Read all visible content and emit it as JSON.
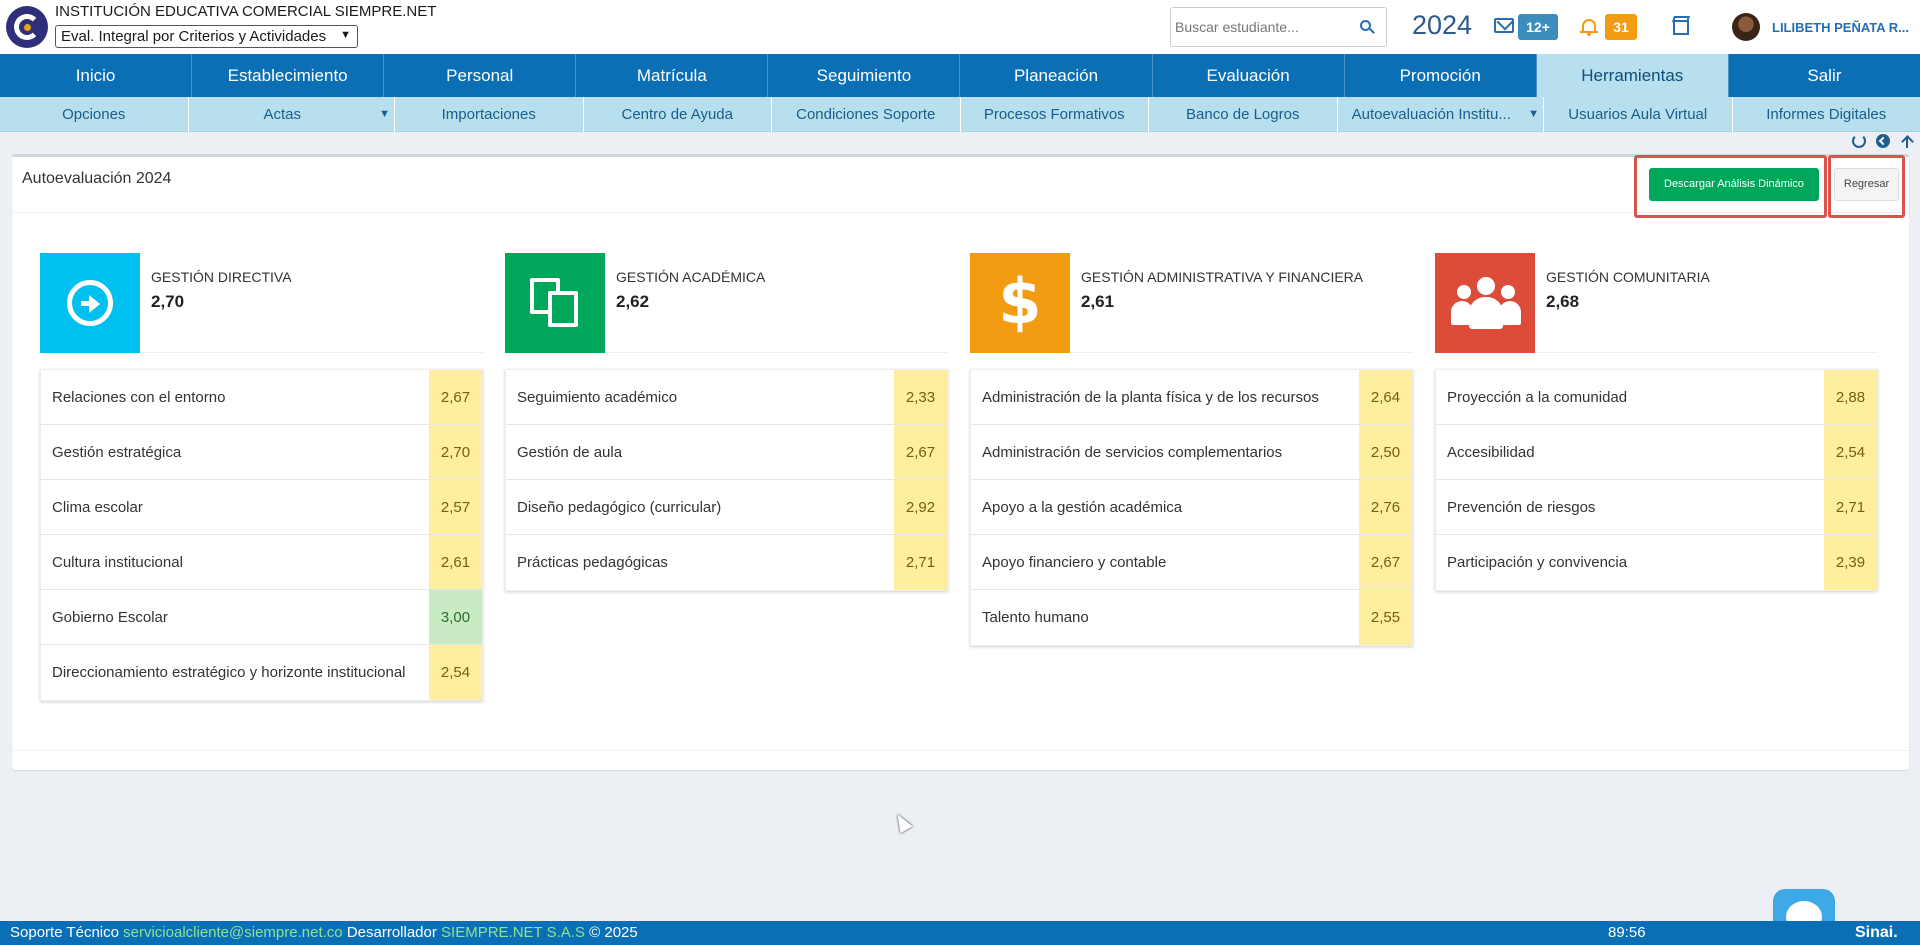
{
  "header": {
    "institution": "INSTITUCIÓN EDUCATIVA COMERCIAL SIEMPRE.NET",
    "period_select": "Eval. Integral por Criterios y Actividades",
    "search_placeholder": "Buscar estudiante...",
    "year": "2024",
    "mail_badge": "12+",
    "notif_badge": "31",
    "user_name": "LILIBETH PEÑATA R...",
    "colors": {
      "mail_badge": "#3c8dbc",
      "notif_badge": "#f39c12"
    }
  },
  "main_menu": [
    "Inicio",
    "Establecimiento",
    "Personal",
    "Matrícula",
    "Seguimiento",
    "Planeación",
    "Evaluación",
    "Promoción",
    "Herramientas",
    "Salir"
  ],
  "main_menu_active": "Herramientas",
  "sub_menu": [
    {
      "label": "Opciones",
      "dropdown": false
    },
    {
      "label": "Actas",
      "dropdown": true
    },
    {
      "label": "Importaciones",
      "dropdown": false
    },
    {
      "label": "Centro de Ayuda",
      "dropdown": false
    },
    {
      "label": "Condiciones Soporte",
      "dropdown": false
    },
    {
      "label": "Procesos Formativos",
      "dropdown": false
    },
    {
      "label": "Banco de Logros",
      "dropdown": false
    },
    {
      "label": "Autoevaluación Institu...",
      "dropdown": true
    },
    {
      "label": "Usuarios Aula Virtual",
      "dropdown": false
    },
    {
      "label": "Informes Digitales",
      "dropdown": false
    }
  ],
  "toolbar_icons": [
    "refresh-icon",
    "back-circle-icon",
    "arrow-up-icon"
  ],
  "panel": {
    "title": "Autoevaluación 2024",
    "download_button": "Descargar Análisis Dinámico",
    "back_button": "Regresar"
  },
  "areas": [
    {
      "name": "GESTIÓN DIRECTIVA",
      "score": "2,70",
      "color": "#00c0ef",
      "icon": "arrow-circle-right-icon",
      "items": [
        {
          "label": "Relaciones con el entorno",
          "score": "2,67",
          "level": "medium"
        },
        {
          "label": "Gestión estratégica",
          "score": "2,70",
          "level": "medium"
        },
        {
          "label": "Clima escolar",
          "score": "2,57",
          "level": "medium"
        },
        {
          "label": "Cultura institucional",
          "score": "2,61",
          "level": "medium"
        },
        {
          "label": "Gobierno Escolar",
          "score": "3,00",
          "level": "high"
        },
        {
          "label": "Direccionamiento estratégico y horizonte institucional",
          "score": "2,54",
          "level": "medium"
        }
      ]
    },
    {
      "name": "GESTIÓN ACADÉMICA",
      "score": "2,62",
      "color": "#00a65a",
      "icon": "documents-icon",
      "items": [
        {
          "label": "Seguimiento académico",
          "score": "2,33",
          "level": "medium"
        },
        {
          "label": "Gestión de aula",
          "score": "2,67",
          "level": "medium"
        },
        {
          "label": "Diseño pedagógico (curricular)",
          "score": "2,92",
          "level": "medium"
        },
        {
          "label": "Prácticas pedagógicas",
          "score": "2,71",
          "level": "medium"
        }
      ]
    },
    {
      "name": "GESTIÓN ADMINISTRATIVA Y FINANCIERA",
      "score": "2,61",
      "color": "#f39c12",
      "icon": "dollar-icon",
      "icon_glyph": "$",
      "items": [
        {
          "label": "Administración de la planta física y de los recursos",
          "score": "2,64",
          "level": "medium"
        },
        {
          "label": "Administración de servicios complementarios",
          "score": "2,50",
          "level": "medium"
        },
        {
          "label": "Apoyo a la gestión académica",
          "score": "2,76",
          "level": "medium"
        },
        {
          "label": "Apoyo financiero y contable",
          "score": "2,67",
          "level": "medium"
        },
        {
          "label": "Talento humano",
          "score": "2,55",
          "level": "medium"
        }
      ]
    },
    {
      "name": "GESTIÓN COMUNITARIA",
      "score": "2,68",
      "color": "#dd4b39",
      "icon": "users-icon",
      "items": [
        {
          "label": "Proyección a la comunidad",
          "score": "2,88",
          "level": "medium"
        },
        {
          "label": "Accesibilidad",
          "score": "2,54",
          "level": "medium"
        },
        {
          "label": "Prevención de riesgos",
          "score": "2,71",
          "level": "medium"
        },
        {
          "label": "Participación y convivencia",
          "score": "2,39",
          "level": "medium"
        }
      ]
    }
  ],
  "footer": {
    "support_label": "Soporte Técnico",
    "support_email": "servicioalcliente@siempre.net.co",
    "developer_label": "Desarrollador",
    "developer_name": "SIEMPRE.NET S.A.S",
    "copyright": "© 2025",
    "timer": "89:56",
    "brand": "Sinai."
  }
}
